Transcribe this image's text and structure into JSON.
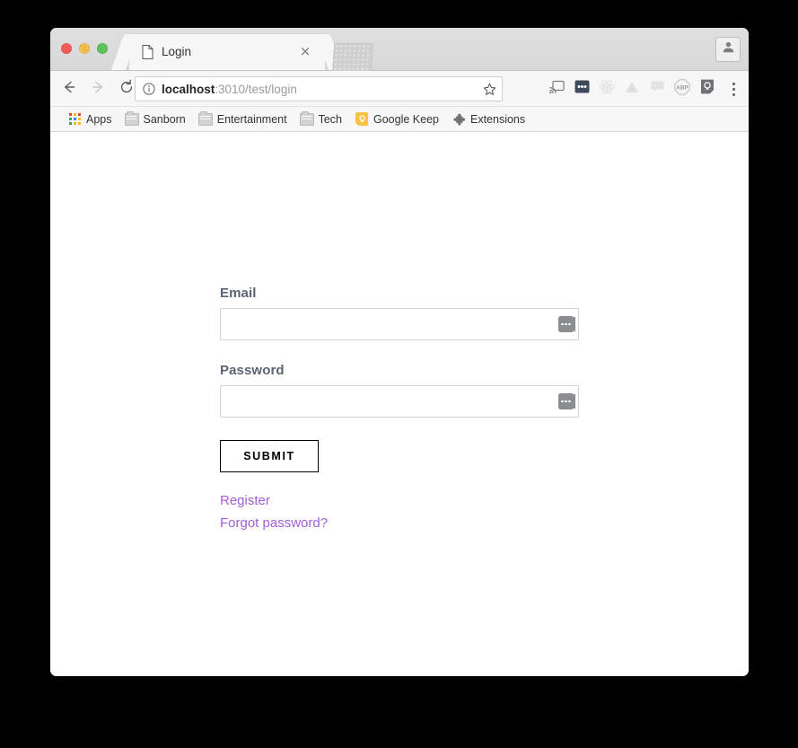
{
  "window": {
    "traffic_lights": [
      "close",
      "minimize",
      "maximize"
    ]
  },
  "tabs": {
    "active": {
      "title": "Login",
      "favicon": "page-icon",
      "close_label": "×"
    },
    "new_tab_label": ""
  },
  "toolbar": {
    "back_icon": "arrow-left-icon",
    "forward_icon": "arrow-right-icon",
    "reload_icon": "reload-icon",
    "omnibox": {
      "info_icon": "info-circle-icon",
      "url_host": "localhost",
      "url_rest": ":3010/test/login",
      "full_url": "localhost:3010/test/login",
      "star_icon": "star-icon"
    },
    "extensions": [
      {
        "name": "cast-icon",
        "label": "Cast"
      },
      {
        "name": "lastpass-icon",
        "label": "LastPass"
      },
      {
        "name": "react-devtools-icon",
        "label": "React Developer Tools"
      },
      {
        "name": "google-drive-icon",
        "label": "Save to Google Drive"
      },
      {
        "name": "chat-bubble-icon",
        "label": "Chat"
      },
      {
        "name": "adblock-plus-icon",
        "label": "ABP"
      },
      {
        "name": "google-keep-icon",
        "label": "Google Keep"
      }
    ],
    "menu_icon": "three-dot-menu-icon",
    "profile_icon": "person-icon"
  },
  "bookmarks": [
    {
      "label": "Apps",
      "icon": "apps-grid-icon"
    },
    {
      "label": "Sanborn",
      "icon": "folder-icon"
    },
    {
      "label": "Entertainment",
      "icon": "folder-icon"
    },
    {
      "label": "Tech",
      "icon": "folder-icon"
    },
    {
      "label": "Google Keep",
      "icon": "keep-bulb-icon"
    },
    {
      "label": "Extensions",
      "icon": "puzzle-piece-icon"
    }
  ],
  "page": {
    "form": {
      "email": {
        "label": "Email",
        "value": "",
        "placeholder": "",
        "autofill_icon": "lastpass-dots-icon"
      },
      "password": {
        "label": "Password",
        "value": "",
        "placeholder": "",
        "autofill_icon": "lastpass-dots-icon"
      },
      "submit_label": "SUBMIT",
      "links": [
        {
          "label": "Register"
        },
        {
          "label": "Forgot password?"
        }
      ]
    }
  },
  "colors": {
    "link": "#a45ed8",
    "label_text": "#5a6472",
    "button_border": "#000000",
    "input_border": "#d3d3d3",
    "chrome_tabstrip": "#dddddd",
    "chrome_toolbar": "#f7f7f7",
    "page_background": "#ffffff",
    "desktop_background": "#000000",
    "keep_yellow": "#f6c344",
    "lastpass_badge": "#8b8e91"
  }
}
